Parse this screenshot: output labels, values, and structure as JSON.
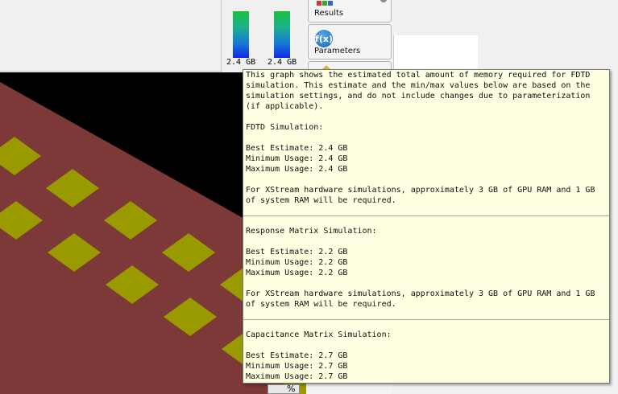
{
  "memory_bars": [
    {
      "label": "2.4 GB",
      "fraction": 1.0
    },
    {
      "label": "2.4 GB",
      "fraction": 1.0
    }
  ],
  "toolbar": {
    "results_label": "Results",
    "parameters_label": "Parameters",
    "fx_glyph": "f(x)"
  },
  "tooltip": {
    "intro": "This graph shows the estimated total amount of memory required for FDTD simulation. This estimate and the min/max values below are based on the simulation settings, and do not include changes due to parameterization (if applicable).",
    "sections": [
      {
        "title": "FDTD Simulation:",
        "best": "Best Estimate: 2.4 GB",
        "min": "Minimum Usage: 2.4 GB",
        "max": "Maximum Usage: 2.4 GB",
        "note": "For XStream hardware simulations, approximately 3 GB of GPU RAM and 1 GB of system RAM will be required."
      },
      {
        "title": "Response Matrix Simulation:",
        "best": "Best Estimate: 2.2 GB",
        "min": "Minimum Usage: 2.2 GB",
        "max": "Maximum Usage: 2.2 GB",
        "note": "For XStream hardware simulations, approximately 3 GB of GPU RAM and 1 GB of system RAM will be required."
      },
      {
        "title": "Capacitance Matrix Simulation:",
        "best": "Best Estimate: 2.7 GB",
        "min": "Minimum Usage: 2.7 GB",
        "max": "Maximum Usage: 2.7 GB"
      }
    ]
  },
  "bottom": {
    "percent_glyph": "%"
  },
  "colors": {
    "board": "#7d3838",
    "pad": "#999900",
    "background": "#000000",
    "tooltip_bg": "#ffffe1"
  }
}
